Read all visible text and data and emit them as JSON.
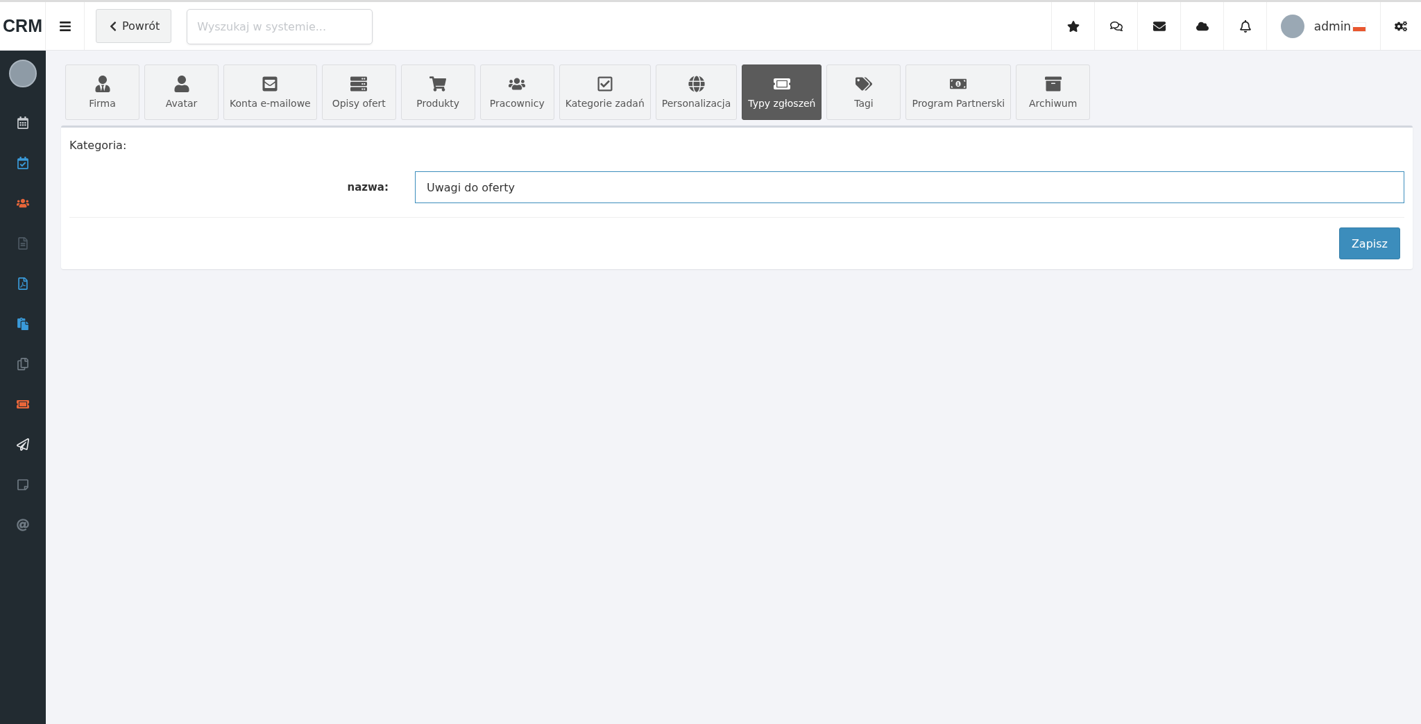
{
  "topbar": {
    "logo": "CRM",
    "back_button": "Powrót",
    "search": {
      "placeholder": "Wyszukaj w systemie..."
    },
    "user": {
      "name": "admin"
    }
  },
  "sidebar": {
    "items": [
      {
        "color": "#c8ccd0"
      },
      {
        "color": "#3a9ad9"
      },
      {
        "color": "#e8663a"
      },
      {
        "color": "#4d5963"
      },
      {
        "color": "#3a9ad9"
      },
      {
        "color": "#3a9ad9"
      },
      {
        "color": "#6f7a83"
      },
      {
        "color": "#e8663a"
      },
      {
        "color": "#e6e8ea"
      },
      {
        "color": "#6f7a83"
      },
      {
        "color": "#6f7a83"
      }
    ]
  },
  "tabs": [
    {
      "label": "Firma",
      "selected": false
    },
    {
      "label": "Avatar",
      "selected": false
    },
    {
      "label": "Konta e-mailowe",
      "selected": false
    },
    {
      "label": "Opisy ofert",
      "selected": false
    },
    {
      "label": "Produkty",
      "selected": false
    },
    {
      "label": "Pracownicy",
      "selected": false
    },
    {
      "label": "Kategorie zadań",
      "selected": false
    },
    {
      "label": "Personalizacja",
      "selected": false
    },
    {
      "label": "Typy zgłoszeń",
      "selected": true
    },
    {
      "label": "Tagi",
      "selected": false
    },
    {
      "label": "Program Partnerski",
      "selected": false
    },
    {
      "label": "Archiwum",
      "selected": false
    }
  ],
  "form": {
    "title": "Kategoria:",
    "fields": [
      {
        "label": "nazwa:",
        "value": "Uwagi do oferty"
      }
    ],
    "submit": "Zapisz"
  }
}
